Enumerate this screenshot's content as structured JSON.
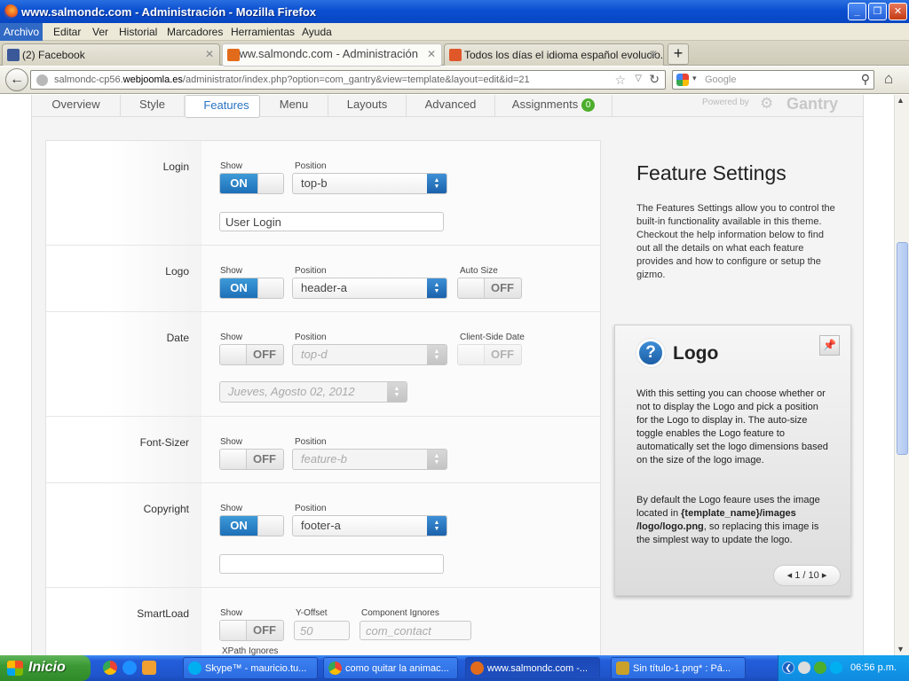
{
  "window": {
    "title": "www.salmondc.com - Administración - Mozilla Firefox",
    "minimize": "_",
    "maximize": "❐",
    "close": "✕"
  },
  "menu": [
    "Archivo",
    "Editar",
    "Ver",
    "Historial",
    "Marcadores",
    "Herramientas",
    "Ayuda"
  ],
  "tabs": [
    {
      "label": "(2) Facebook",
      "color": "#3b5998",
      "close": "✕"
    },
    {
      "label": "www.salmondc.com - Administración",
      "color": "#e26b1b",
      "close": "✕"
    },
    {
      "label": "Todos los días el idioma español evolucio...",
      "color": "#e0582a",
      "close": "✕"
    }
  ],
  "new_tab": "+",
  "nav": {
    "back": "←",
    "url_pre": "salmondc-cp56.",
    "url_host": "webjoomla.es",
    "url_post": "/administrator/index.php?option=com_gantry&view=template&layout=edit&id=21",
    "star": "☆",
    "dropdown": "▽",
    "reload": "↻",
    "search_placeholder": "Google",
    "search_dd": "▾",
    "search_icon": "⚲",
    "home": "⌂"
  },
  "gantry": {
    "tabs": [
      "Overview",
      "Style",
      "Features",
      "Menu",
      "Layouts",
      "Advanced",
      "Assignments"
    ],
    "assignments_badge": "0",
    "powered_by": "Powered by",
    "logo_text": "Gantry",
    "cog": "⚙"
  },
  "settings": {
    "login": {
      "label": "Login",
      "show_cap": "Show",
      "toggle": "ON",
      "toggle_off": "OFF",
      "position_cap": "Position",
      "position": "top-b",
      "text": "User Login"
    },
    "logo": {
      "label": "Logo",
      "show_cap": "Show",
      "toggle": "ON",
      "toggle_off": "OFF",
      "position_cap": "Position",
      "position": "header-a",
      "autosize_cap": "Auto Size",
      "autosize": "OFF"
    },
    "date": {
      "label": "Date",
      "show_cap": "Show",
      "toggle": "OFF",
      "position_cap": "Position",
      "position": "top-d",
      "clientside_cap": "Client-Side Date",
      "clientside": "OFF",
      "format": "Jueves, Agosto 02, 2012"
    },
    "fontsizer": {
      "label": "Font-Sizer",
      "show_cap": "Show",
      "toggle": "OFF",
      "position_cap": "Position",
      "position": "feature-b"
    },
    "copyright": {
      "label": "Copyright",
      "show_cap": "Show",
      "toggle": "ON",
      "toggle_off": "OFF",
      "position_cap": "Position",
      "position": "footer-a",
      "text": ""
    },
    "smartload": {
      "label": "SmartLoad",
      "show_cap": "Show",
      "toggle": "OFF",
      "yoffset_cap": "Y-Offset",
      "yoffset": "50",
      "ignores_cap": "Component Ignores",
      "ignores": "com_contact",
      "xpath_cap": "XPath Ignores"
    },
    "arrow_up": "▲",
    "arrow_down": "▼"
  },
  "side": {
    "title": "Feature Settings",
    "desc": "The Features Settings allow you to control the built-in functionality available in this theme. Checkout the help information below to find out all the details on what each feature provides and how to configure or setup the gizmo."
  },
  "help": {
    "icon": "?",
    "title": "Logo",
    "pin": "📌",
    "p1": "With this setting you can choose whether or not to display the Logo and pick a position for the Logo to display in. The auto-size toggle enables the Logo feature to automatically set the logo dimensions based on the size of the logo image.",
    "p2_pre": "By default the Logo feaure uses the image located in ",
    "p2_bold": "{template_name}/images /logo/logo.png",
    "p2_post": ", so replacing this image is the simplest way to update the logo.",
    "pager_prev": "◂",
    "pager": "1 / 10",
    "pager_next": "▸"
  },
  "scroll": {
    "up": "▲",
    "down": "▼"
  },
  "taskbar": {
    "start": "Inicio",
    "tasks": [
      {
        "label": "Skype™ - mauricio.tu...",
        "color": "#00aff0"
      },
      {
        "label": "como quitar la animac...",
        "color": "#e94b3c"
      },
      {
        "label": "www.salmondc.com -...",
        "color": "#e26b1b"
      },
      {
        "label": "Sin título-1.png* : Pá...",
        "color": "#c8a02a"
      }
    ],
    "tray_arrow": "❮",
    "clock": "06:56 p.m."
  }
}
